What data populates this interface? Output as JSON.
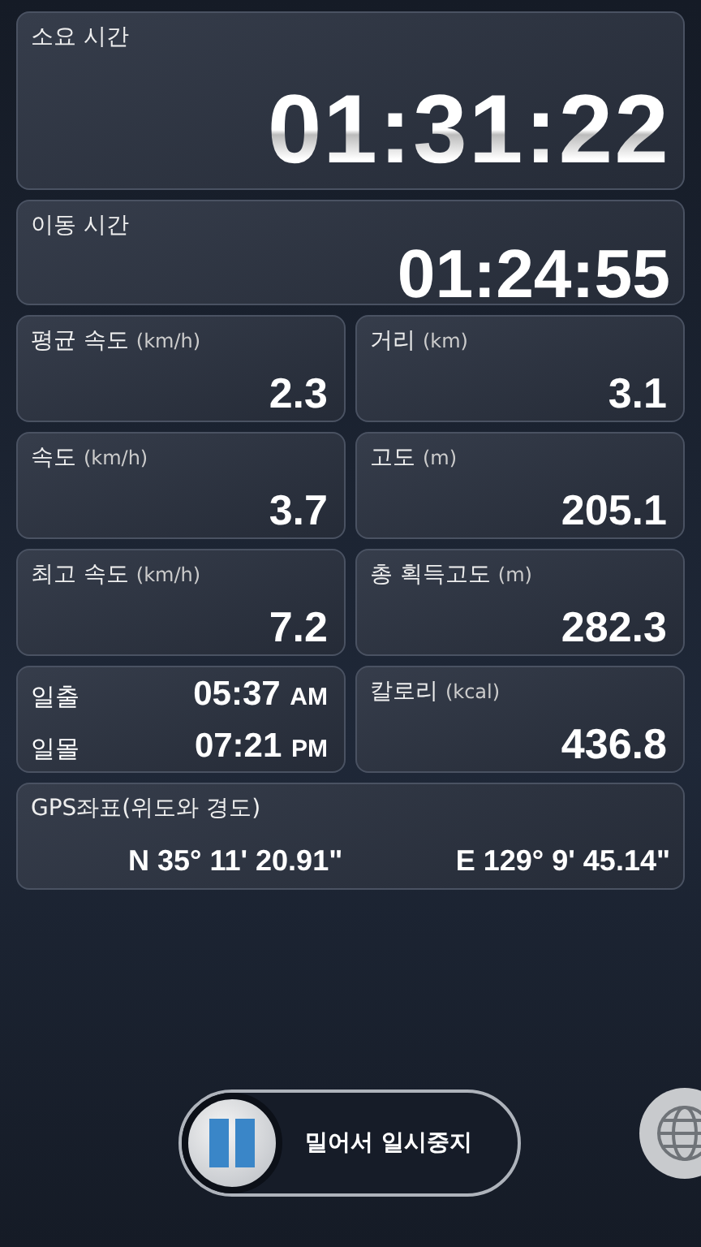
{
  "elapsed": {
    "label": "소요 시간",
    "value": "01:31:22"
  },
  "moving": {
    "label": "이동 시간",
    "value": "01:24:55"
  },
  "stats": [
    {
      "kind": "metric",
      "label": "평균 속도",
      "unit": "(km/h)",
      "value": "2.3"
    },
    {
      "kind": "metric",
      "label": "거리",
      "unit": "(km)",
      "value": "3.1"
    },
    {
      "kind": "metric",
      "label": "속도",
      "unit": "(km/h)",
      "value": "3.7"
    },
    {
      "kind": "metric",
      "label": "고도",
      "unit": "(m)",
      "value": "205.1"
    },
    {
      "kind": "metric",
      "label": "최고 속도",
      "unit": "(km/h)",
      "value": "7.2"
    },
    {
      "kind": "metric",
      "label": "총 획득고도",
      "unit": "(m)",
      "value": "282.3"
    },
    {
      "kind": "sun",
      "rows": [
        {
          "label": "일출",
          "time": "05:37",
          "ampm": "AM"
        },
        {
          "label": "일몰",
          "time": "07:21",
          "ampm": "PM"
        }
      ]
    },
    {
      "kind": "metric",
      "label": "칼로리",
      "unit": "(kcal)",
      "value": "436.8"
    }
  ],
  "gps": {
    "label": "GPS좌표(위도와 경도)",
    "latitude": "N 35° 11' 20.91\"",
    "longitude": "E 129° 9' 45.14\""
  },
  "slider": {
    "label": "밀어서 일시중지",
    "level": 0
  }
}
